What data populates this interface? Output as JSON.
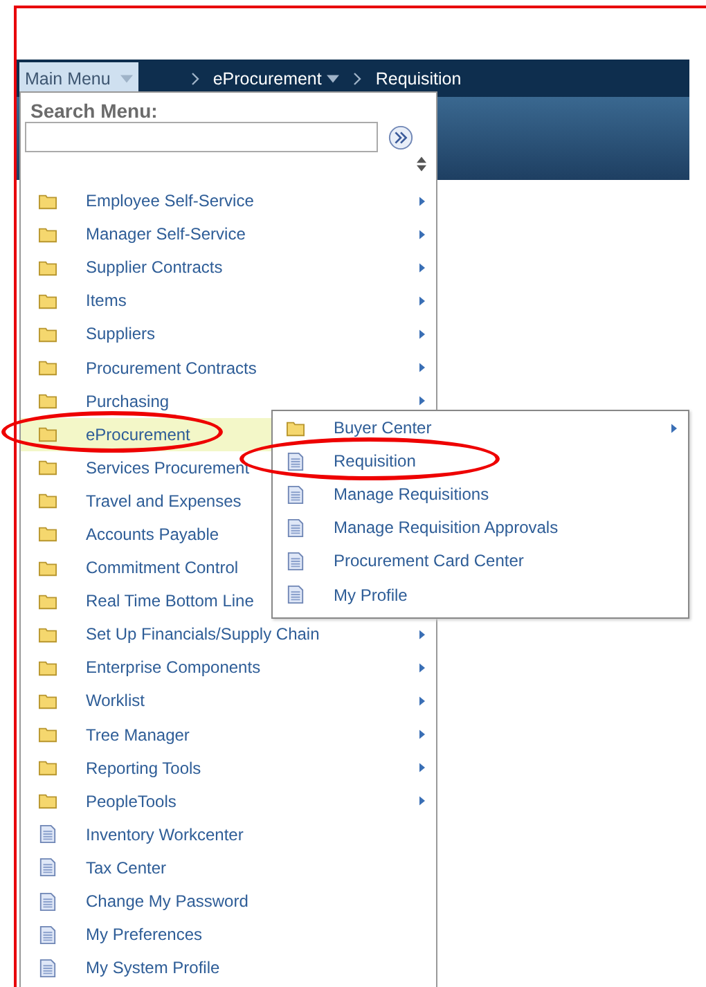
{
  "nav": {
    "main_menu": "Main Menu",
    "breadcrumbs": [
      {
        "label": "eProcurement",
        "dropdown": true
      },
      {
        "label": "Requisition",
        "dropdown": false
      }
    ]
  },
  "menu": {
    "search_label": "Search Menu:",
    "items": [
      {
        "label": "Employee Self-Service",
        "kind": "folder",
        "selected": false,
        "circled": false
      },
      {
        "label": "Manager Self-Service",
        "kind": "folder",
        "selected": false,
        "circled": false
      },
      {
        "label": "Supplier Contracts",
        "kind": "folder",
        "selected": false,
        "circled": false
      },
      {
        "label": "Items",
        "kind": "folder",
        "selected": false,
        "circled": false
      },
      {
        "label": "Suppliers",
        "kind": "folder",
        "selected": false,
        "circled": false
      },
      {
        "label": "Procurement Contracts",
        "kind": "folder",
        "selected": false,
        "circled": false
      },
      {
        "label": "Purchasing",
        "kind": "folder",
        "selected": false,
        "circled": false
      },
      {
        "label": "eProcurement",
        "kind": "folder",
        "selected": true,
        "circled": true
      },
      {
        "label": "Services Procurement",
        "kind": "folder",
        "selected": false,
        "circled": false
      },
      {
        "label": "Travel and Expenses",
        "kind": "folder",
        "selected": false,
        "circled": false
      },
      {
        "label": "Accounts Payable",
        "kind": "folder",
        "selected": false,
        "circled": false
      },
      {
        "label": "Commitment Control",
        "kind": "folder",
        "selected": false,
        "circled": false
      },
      {
        "label": "Real Time Bottom Line",
        "kind": "folder",
        "selected": false,
        "circled": false
      },
      {
        "label": "Set Up Financials/Supply Chain",
        "kind": "folder",
        "selected": false,
        "circled": false
      },
      {
        "label": "Enterprise Components",
        "kind": "folder",
        "selected": false,
        "circled": false
      },
      {
        "label": "Worklist",
        "kind": "folder",
        "selected": false,
        "circled": false
      },
      {
        "label": "Tree Manager",
        "kind": "folder",
        "selected": false,
        "circled": false
      },
      {
        "label": "Reporting Tools",
        "kind": "folder",
        "selected": false,
        "circled": false
      },
      {
        "label": "PeopleTools",
        "kind": "folder",
        "selected": false,
        "circled": false
      },
      {
        "label": "Inventory Workcenter",
        "kind": "page",
        "selected": false,
        "circled": false
      },
      {
        "label": "Tax Center",
        "kind": "page",
        "selected": false,
        "circled": false
      },
      {
        "label": "Change My Password",
        "kind": "page",
        "selected": false,
        "circled": false
      },
      {
        "label": "My Preferences",
        "kind": "page",
        "selected": false,
        "circled": false
      },
      {
        "label": "My System Profile",
        "kind": "page",
        "selected": false,
        "circled": false
      }
    ]
  },
  "submenu": {
    "items": [
      {
        "label": "Buyer Center",
        "kind": "folder",
        "circled": false
      },
      {
        "label": "Requisition",
        "kind": "page",
        "circled": true
      },
      {
        "label": "Manage Requisitions",
        "kind": "page",
        "circled": false
      },
      {
        "label": "Manage Requisition Approvals",
        "kind": "page",
        "circled": false
      },
      {
        "label": "Procurement Card Center",
        "kind": "page",
        "circled": false
      },
      {
        "label": "My Profile",
        "kind": "page",
        "circled": false
      }
    ]
  }
}
